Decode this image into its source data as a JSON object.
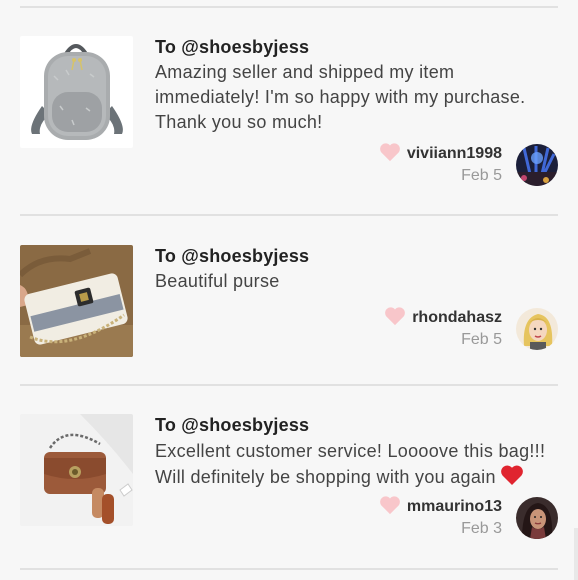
{
  "reviews": [
    {
      "to": "To @shoesbyjess",
      "text_lines": [
        "Amazing seller and shipped my item",
        "immediately! I'm so happy with my purchase.",
        "Thank you so much!"
      ],
      "username": "viviiann1998",
      "date": "Feb 5",
      "product_icon": "gray-furry-backpack",
      "avatar_icon": "concert-lights-avatar"
    },
    {
      "to": "To @shoesbyjess",
      "text_lines": [
        "Beautiful purse"
      ],
      "username": "rhondahasz",
      "date": "Feb 5",
      "product_icon": "white-chain-purse",
      "avatar_icon": "cartoon-blonde-avatar"
    },
    {
      "to": "To @shoesbyjess",
      "text_lines": [
        "Excellent customer service! Loooove this bag!!!",
        "Will definitely be shopping with you again"
      ],
      "username": "mmaurino13",
      "date": "Feb 3",
      "product_icon": "brown-crossbody-bag",
      "avatar_icon": "woman-portrait-avatar"
    }
  ],
  "colors": {
    "like_heart": "#f8c6ca",
    "red_heart_emoji": "#e0242f",
    "divider": "#e1e1e1"
  }
}
